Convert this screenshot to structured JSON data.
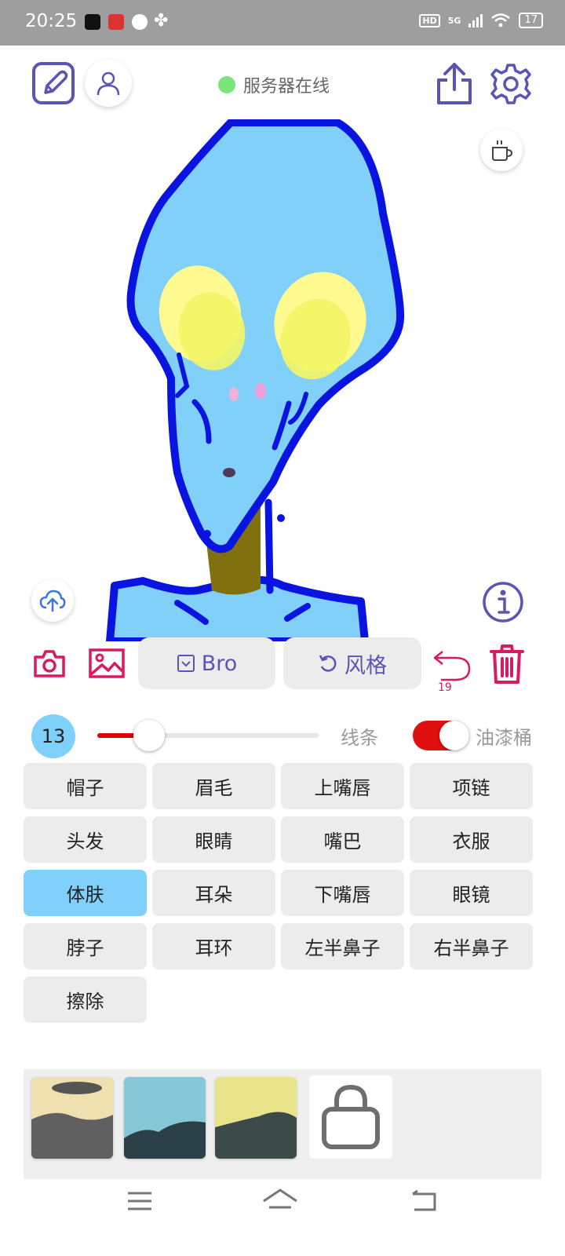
{
  "status_bar": {
    "time": "20:25",
    "hd_badge": "HD",
    "network": "5G",
    "battery": "17"
  },
  "header": {
    "server_status": "服务器在线",
    "server_status_color": "#7be57b",
    "icons": [
      "edit-icon",
      "user-icon",
      "share-icon",
      "settings-icon",
      "coffee-icon"
    ]
  },
  "toolbar": {
    "style_select_label": "Bro",
    "style_button_label": "风格",
    "undo_count": "19"
  },
  "brush": {
    "size": "13",
    "line_label": "线条",
    "bucket_label": "油漆桶",
    "bucket_enabled": true,
    "slider_level_fraction": 0.23
  },
  "parts": [
    [
      "帽子",
      "眉毛",
      "上嘴唇",
      "项链"
    ],
    [
      "头发",
      "眼睛",
      "嘴巴",
      "衣服"
    ],
    [
      "体肤",
      "耳朵",
      "下嘴唇",
      "眼镜"
    ],
    [
      "脖子",
      "耳环",
      "左半鼻子",
      "右半鼻子"
    ],
    [
      "擦除"
    ]
  ],
  "selected_part": "体肤",
  "colors": {
    "accent": "#5a55b5",
    "danger": "#d81b60",
    "active_part": "#7fd0fb",
    "slider_fill": "#e00000"
  }
}
